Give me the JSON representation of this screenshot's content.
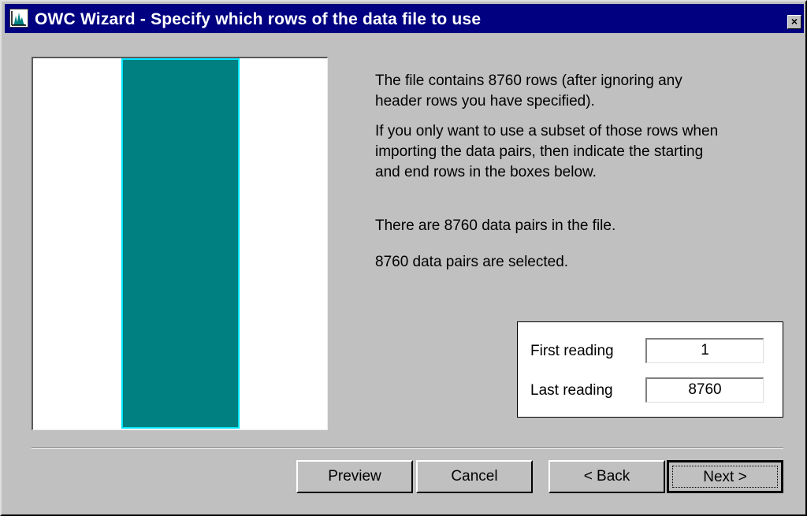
{
  "window": {
    "title": "OWC Wizard - Specify which rows of the data file to use",
    "close_glyph": "×",
    "app_icon": "chart-icon"
  },
  "info": {
    "paragraph1": "The file contains 8760 rows (after ignoring any header rows you have specified).",
    "paragraph2": "If you only want to use a subset of those rows when importing the data pairs, then indicate the starting and end rows in the boxes below.",
    "paragraph3": "There are 8760 data pairs in the file.",
    "paragraph4": "8760 data pairs are selected."
  },
  "readings": {
    "first_label": "First reading",
    "first_value": "1",
    "last_label": "Last reading",
    "last_value": "8760"
  },
  "buttons": {
    "preview": "Preview",
    "cancel": "Cancel",
    "back": "< Back",
    "next": "Next >"
  },
  "colors": {
    "selection_fill": "#008080",
    "selection_border": "#00e5ff",
    "titlebar": "#000080"
  }
}
